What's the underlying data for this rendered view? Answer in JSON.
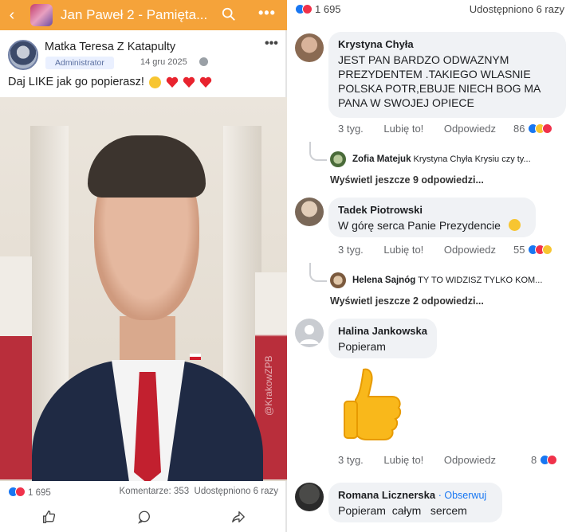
{
  "left": {
    "header": {
      "title": "Jan Paweł 2 - Pamięta...",
      "back_icon": "chevron-left-icon",
      "search_icon": "search-icon",
      "more_icon": "ellipsis-icon",
      "bg": "#f5a33a"
    },
    "post": {
      "author": "Matka Teresa Z Katapulty",
      "badge": "Administrator",
      "date": "14 gru 2025",
      "text": "Daj LIKE jak go popierasz!",
      "watermark": "@KrakowZPB",
      "reactions_count": "1 695",
      "comments": "Komentarze: 353",
      "shares": "Udostępniono 6 razy"
    }
  },
  "right": {
    "top": {
      "reactions_count": "1 695",
      "shares": "Udostępniono 6 razy"
    },
    "comments": [
      {
        "name": "Krystyna Chyła",
        "text": "JEST PAN BARDZO ODWAZNYM PREZYDENTEM .TAKIEGO WLASNIE POLSKA POTR,EBUJE NIECH BOG MA PANA W SWOJEJ OPIECE",
        "time": "3 tyg.",
        "like": "Lubię to!",
        "reply": "Odpowiedz",
        "count": "86",
        "reply_preview": {
          "name": "Zofia Matejuk",
          "text": "Krystyna Chyła Krysiu czy ty..."
        },
        "more": "Wyświetl jeszcze 9 odpowiedzi..."
      },
      {
        "name": "Tadek Piotrowski",
        "text": "W górę serca Panie Prezydencie",
        "time": "3 tyg.",
        "like": "Lubię to!",
        "reply": "Odpowiedz",
        "count": "55",
        "reply_preview": {
          "name": "Helena Sajnóg",
          "text": "TY TO WIDZISZ TYLKO KOM..."
        },
        "more": "Wyświetl jeszcze 2 odpowiedzi..."
      },
      {
        "name": "Halina Jankowska",
        "text": "Popieram",
        "time": "3 tyg.",
        "like": "Lubię to!",
        "reply": "Odpowiedz",
        "count": "8"
      },
      {
        "name": "Romana Licznerska",
        "follow": "Obserwuj",
        "text": "Popieram  całym   sercem"
      }
    ]
  }
}
